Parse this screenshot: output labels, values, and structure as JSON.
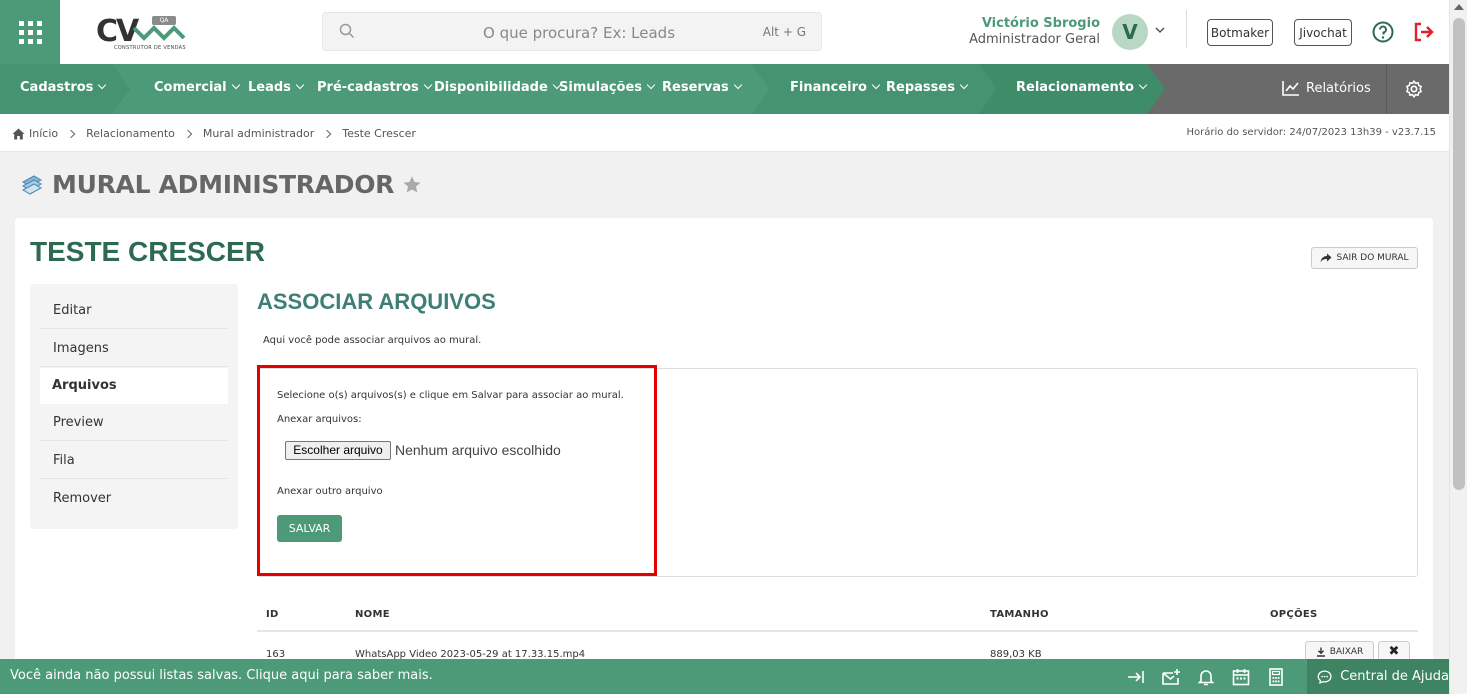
{
  "header": {
    "logo_text": "CV",
    "logo_badge": "QA",
    "logo_subtitle": "CONSTRUTOR DE VENDAS",
    "search_placeholder": "O que procura? Ex: Leads",
    "search_shortcut": "Alt + G",
    "user_name": "Victório Sbrogio",
    "user_role": "Administrador Geral",
    "avatar_initial": "V",
    "btn_botmaker": "Botmaker",
    "btn_jivochat": "Jivochat",
    "icons": [
      "apps-grid-icon",
      "search-icon",
      "chevron-down-icon",
      "help-icon",
      "logout-icon"
    ],
    "accent_color": "#4c9a78",
    "logout_color": "#e0202b"
  },
  "nav": {
    "items": [
      "Cadastros",
      "Comercial",
      "Leads",
      "Pré-cadastros",
      "Disponibilidade",
      "Simulações",
      "Reservas",
      "Financeiro",
      "Repasses",
      "Relacionamento"
    ],
    "reports": "Relatórios"
  },
  "breadcrumb": {
    "items": [
      "Início",
      "Relacionamento",
      "Mural administrador",
      "Teste Crescer"
    ],
    "server_time": "Horário do servidor: 24/07/2023 13h39 - v23.7.15"
  },
  "page": {
    "title": "MURAL ADMINISTRADOR"
  },
  "mural": {
    "title": "TESTE CRESCER",
    "exit_label": "SAIR DO MURAL",
    "side_menu": [
      "Editar",
      "Imagens",
      "Arquivos",
      "Preview",
      "Fila",
      "Remover"
    ],
    "active_item": "Arquivos"
  },
  "assoc": {
    "title": "ASSOCIAR ARQUIVOS",
    "description": "Aqui você pode associar arquivos ao mural.",
    "instruction": "Selecione o(s) arquivos(s) e clique em Salvar para associar ao mural.",
    "attach_label": "Anexar arquivos:",
    "file_button": "Escolher arquivo",
    "file_status": "Nenhum arquivo escolhido",
    "add_another": "Anexar outro arquivo",
    "save_label": "SALVAR"
  },
  "table": {
    "headers": [
      "ID",
      "NOME",
      "TAMANHO",
      "OPÇÕES"
    ],
    "rows": [
      {
        "id": "163",
        "name": "WhatsApp Video 2023-05-29 at 17.33.15.mp4",
        "size": "889,03 KB",
        "download": "BAIXAR"
      }
    ]
  },
  "bottom": {
    "message": "Você ainda não possui listas salvas. Clique aqui para saber mais.",
    "help_center": "Central de Ajuda"
  }
}
